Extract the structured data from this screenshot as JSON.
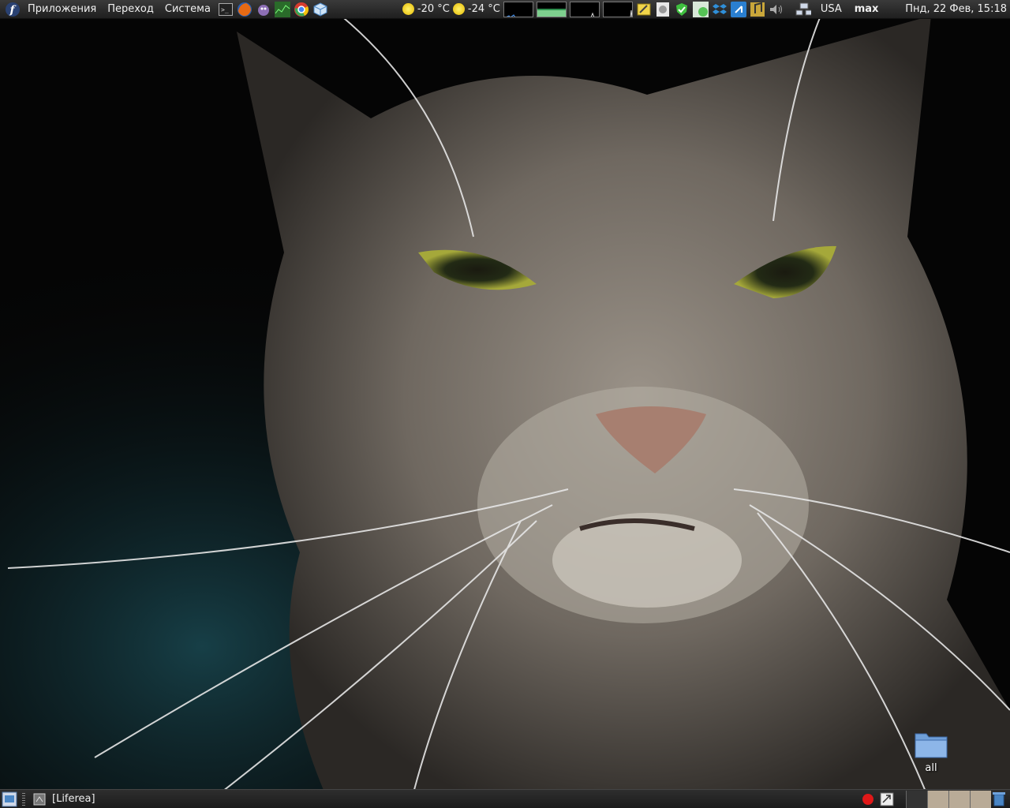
{
  "top_panel": {
    "menus": [
      "Приложения",
      "Переход",
      "Система"
    ],
    "launchers": [
      "terminal-icon",
      "firefox-icon",
      "pidgin-icon",
      "gnome-system-monitor-icon",
      "chrome-icon",
      "virtualbox-icon"
    ],
    "weather": [
      {
        "icon": "sun-icon",
        "temp": "-20 °C"
      },
      {
        "icon": "sun-icon",
        "temp": "-24 °C"
      }
    ],
    "tray": [
      "notes-icon",
      "gpg-icon",
      "update-ok-icon",
      "network-activity-icon",
      "dropbox-icon",
      "bluetooth-icon",
      "music-icon",
      "volume-icon",
      "network-icon"
    ],
    "keyboard_layout": "USA",
    "username": "max",
    "clock": "Пнд, 22 Фев, 15:18"
  },
  "desktop": {
    "icons": [
      {
        "label": "all",
        "icon": "folder-icon"
      }
    ]
  },
  "bottom_panel": {
    "tasks": [
      {
        "label": "[Liferea]",
        "icon": "liferea-icon"
      }
    ],
    "tray": [
      "record-icon",
      "tomboy-icon"
    ],
    "workspaces": 4,
    "active_workspace": 1
  },
  "colors": {
    "panel": "#262626",
    "workspace_inactive": "#b9ab97",
    "accent_blue": "#3f7fc8"
  }
}
